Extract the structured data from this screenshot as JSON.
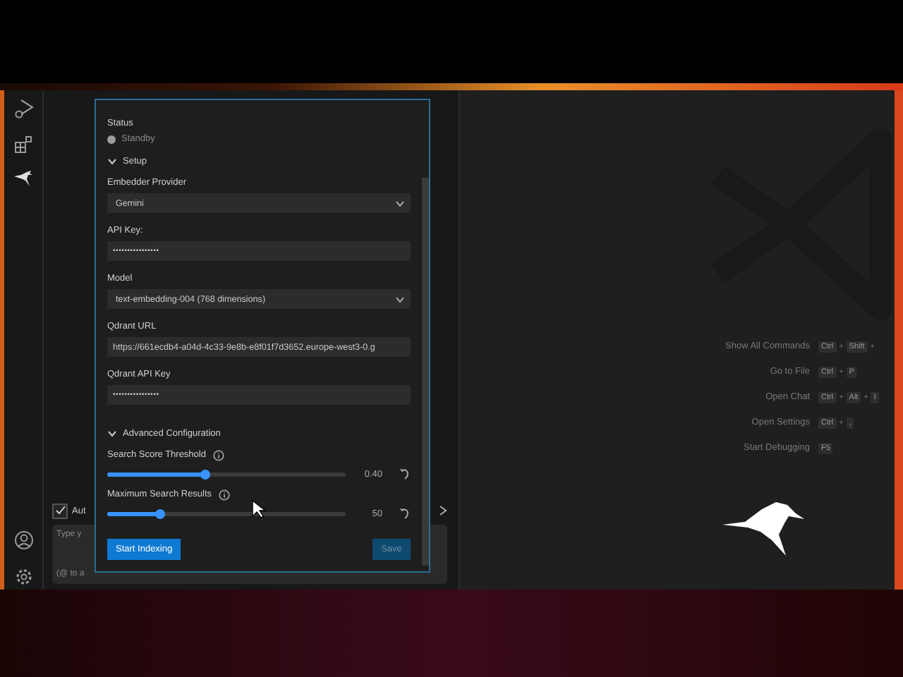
{
  "chat_background": {
    "auto_approve": {
      "label": "Aut",
      "checked": true
    },
    "input": {
      "placeholder": "Type y",
      "hint": "(@ to a"
    }
  },
  "settings_panel": {
    "status": {
      "label": "Status",
      "text": "Standby",
      "color": "#9d9d9d"
    },
    "setup": {
      "title": "Setup",
      "expanded": true,
      "fields": [
        {
          "kind": "select",
          "label": "Embedder Provider",
          "value": "Gemini"
        },
        {
          "kind": "password",
          "label": "API Key:",
          "value": "••••••••••••••••"
        },
        {
          "kind": "select",
          "label": "Model",
          "value": "text-embedding-004 (768 dimensions)"
        },
        {
          "kind": "text",
          "label": "Qdrant URL",
          "value": "https://661ecdb4-a04d-4c33-9e8b-e8f01f7d3652.europe-west3-0.g"
        },
        {
          "kind": "password",
          "label": "Qdrant API Key",
          "value": "••••••••••••••••"
        }
      ]
    },
    "advanced": {
      "title": "Advanced Configuration",
      "expanded": true,
      "sliders": [
        {
          "label": "Search Score Threshold",
          "level": 0.41,
          "reading": "0.40"
        },
        {
          "label": "Maximum Search Results",
          "level": 0.22,
          "reading": "50"
        }
      ]
    },
    "buttons": [
      {
        "label": "Start Indexing",
        "disabled": false
      },
      {
        "label": "Save",
        "disabled": true
      }
    ]
  },
  "editor": {
    "shortcuts": [
      {
        "label": "Show All Commands",
        "keys": [
          {
            "kind": "key",
            "text": "Ctrl"
          },
          {
            "kind": "plus",
            "text": "+"
          },
          {
            "kind": "key",
            "text": "Shift"
          },
          {
            "kind": "plus",
            "text": "+"
          }
        ]
      },
      {
        "label": "Go to File",
        "keys": [
          {
            "kind": "key",
            "text": "Ctrl"
          },
          {
            "kind": "plus",
            "text": "+"
          },
          {
            "kind": "key",
            "text": "P"
          }
        ]
      },
      {
        "label": "Open Chat",
        "keys": [
          {
            "kind": "key",
            "text": "Ctrl"
          },
          {
            "kind": "plus",
            "text": "+"
          },
          {
            "kind": "key",
            "text": "Alt"
          },
          {
            "kind": "plus",
            "text": "+"
          },
          {
            "kind": "key",
            "text": "I"
          }
        ]
      },
      {
        "label": "Open Settings",
        "keys": [
          {
            "kind": "key",
            "text": "Ctrl"
          },
          {
            "kind": "plus",
            "text": "+"
          },
          {
            "kind": "key",
            "text": ","
          }
        ]
      },
      {
        "label": "Start Debugging",
        "keys": [
          {
            "kind": "key",
            "text": "F5"
          }
        ]
      }
    ]
  }
}
